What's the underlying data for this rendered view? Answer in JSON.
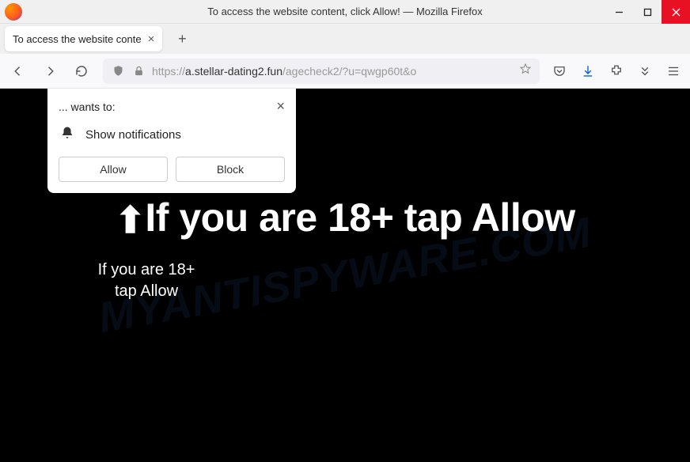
{
  "window": {
    "title": "To access the website content, click Allow! — Mozilla Firefox"
  },
  "tab": {
    "title": "To access the website conte"
  },
  "url": {
    "proto": "https://",
    "host": "a.stellar-dating2.fun",
    "path": "/agecheck2/?u=qwgp60t&o"
  },
  "permission": {
    "wants": "... wants to:",
    "message": "Show notifications",
    "allow": "Allow",
    "block": "Block"
  },
  "page": {
    "big": "If you are 18+ tap Allow",
    "small": "If you are 18+ tap Allow"
  },
  "watermark": "MYANTISPYWARE.COM"
}
